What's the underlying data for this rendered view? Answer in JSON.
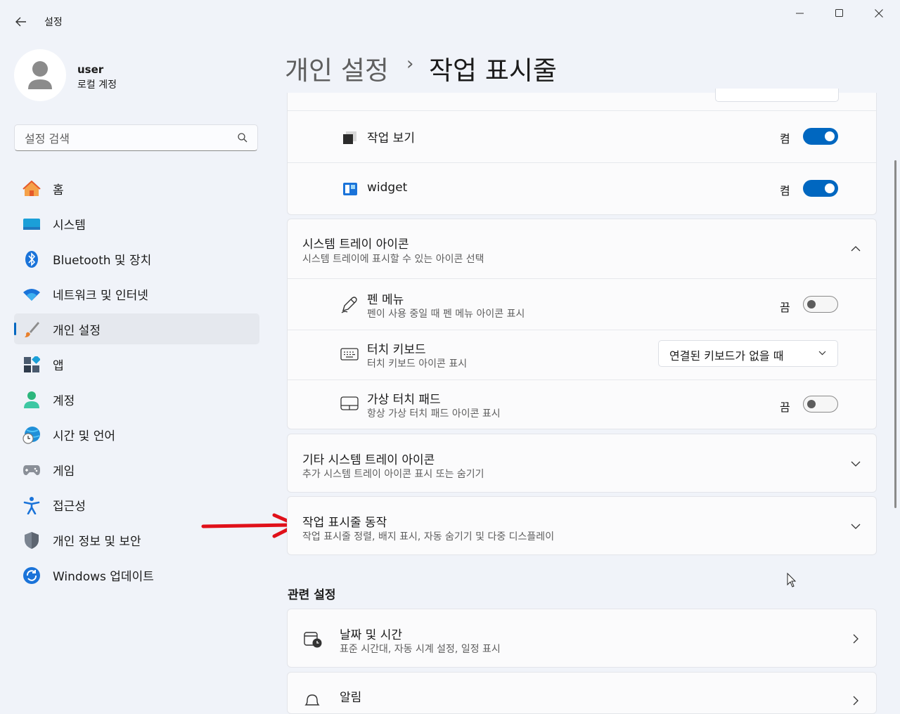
{
  "app": {
    "title": "설정"
  },
  "user": {
    "name": "user",
    "account_type": "로컬 계정"
  },
  "search": {
    "placeholder": "설정 검색"
  },
  "nav": {
    "items": [
      {
        "label": "홈",
        "icon": "home-icon"
      },
      {
        "label": "시스템",
        "icon": "system-icon"
      },
      {
        "label": "Bluetooth 및 장치",
        "icon": "bluetooth-icon"
      },
      {
        "label": "네트워크 및 인터넷",
        "icon": "wifi-icon"
      },
      {
        "label": "개인 설정",
        "icon": "brush-icon",
        "active": true
      },
      {
        "label": "앱",
        "icon": "apps-icon"
      },
      {
        "label": "계정",
        "icon": "account-icon"
      },
      {
        "label": "시간 및 언어",
        "icon": "time-language-icon"
      },
      {
        "label": "게임",
        "icon": "gamepad-icon"
      },
      {
        "label": "접근성",
        "icon": "accessibility-icon"
      },
      {
        "label": "개인 정보 및 보안",
        "icon": "shield-icon"
      },
      {
        "label": "Windows 업데이트",
        "icon": "update-icon"
      }
    ]
  },
  "header": {
    "parent": "개인 설정",
    "current": "작업 표시줄"
  },
  "taskbar_items": {
    "task_view": {
      "label": "작업 보기",
      "state": "켬",
      "on": true
    },
    "widget": {
      "label": "widget",
      "state": "켬",
      "on": true
    }
  },
  "tray_icons": {
    "title": "시스템 트레이 아이콘",
    "subtitle": "시스템 트레이에 표시할 수 있는 아이콘 선택",
    "pen_menu": {
      "title": "펜 메뉴",
      "subtitle": "펜이 사용 중일 때 펜 메뉴 아이콘 표시",
      "state": "끔",
      "on": false
    },
    "touch_keyboard": {
      "title": "터치 키보드",
      "subtitle": "터치 키보드 아이콘 표시",
      "dropdown_value": "연결된 키보드가 없을 때"
    },
    "touchpad": {
      "title": "가상 터치 패드",
      "subtitle": "항상 가상 터치 패드 아이콘 표시",
      "state": "끔",
      "on": false
    }
  },
  "other_tray": {
    "title": "기타 시스템 트레이 아이콘",
    "subtitle": "추가 시스템 트레이 아이콘 표시 또는 숨기기"
  },
  "taskbar_behavior": {
    "title": "작업 표시줄 동작",
    "subtitle": "작업 표시줄 정렬, 배지 표시, 자동 숨기기 및 다중 디스플레이"
  },
  "related": {
    "heading": "관련 설정",
    "date_time": {
      "title": "날짜 및 시간",
      "subtitle": "표준 시간대, 자동 시계 설정, 일정 표시"
    },
    "notifications": {
      "title": "알림"
    }
  },
  "colors": {
    "accent": "#0067c0",
    "annotation_arrow": "#e0101a"
  }
}
